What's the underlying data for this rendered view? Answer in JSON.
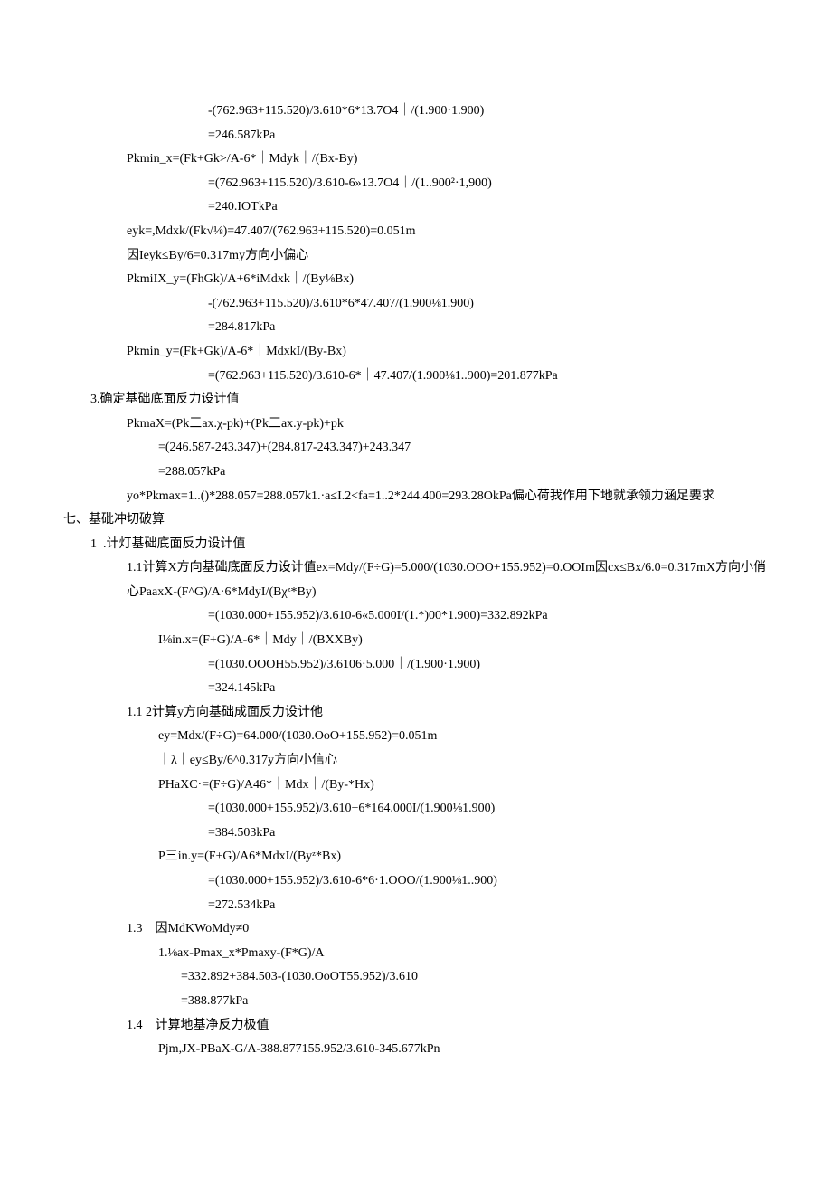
{
  "lines": [
    {
      "indent": 4,
      "text": "-(762.963+115.520)/3.610*6*13.7O4｜/(1.900·1.900)"
    },
    {
      "indent": 4,
      "text": "=246.587kPa"
    },
    {
      "indent": 2,
      "text": "Pkmin_x=(Fk+Gk>/A-6*｜Mdyk｜/(Bx-By)"
    },
    {
      "indent": 4,
      "text": "=(762.963+115.520)/3.610-6»13.7O4｜/(1..900²·1,900)"
    },
    {
      "indent": 4,
      "text": "=240.IOTkPa"
    },
    {
      "indent": 2,
      "text": "eyk=,Mdxk/(Fk√⅛)=47.407/(762.963+115.520)=0.051m"
    },
    {
      "indent": 2,
      "text": "因Ieyk≤By/6=0.317my方向小偏心"
    },
    {
      "indent": 2,
      "text": "PkmiIX_y=(FhGk)/A+6*iMdxk｜/(By⅛Bx)"
    },
    {
      "indent": 4,
      "text": "-(762.963+115.520)/3.610*6*47.407/(1.900⅛1.900)"
    },
    {
      "indent": 4,
      "text": "=284.817kPa"
    },
    {
      "indent": 2,
      "text": "Pkmin_y=(Fk+Gk)/A-6*｜MdxkI/(By-Bx)"
    },
    {
      "indent": 4,
      "text": "=(762.963+115.520)/3.610-6*｜47.407/(1.900⅛1..900)=201.877kPa"
    },
    {
      "indent": 1,
      "text": "3.确定基础底面反力设计值"
    },
    {
      "indent": 2,
      "text": "PkmaX=(Pk三ax.χ-pk)+(Pk三ax.y-pk)+pk"
    },
    {
      "indent": 3,
      "text": "=(246.587-243.347)+(284.817-243.347)+243.347"
    },
    {
      "indent": 3,
      "text": "=288.057kPa"
    },
    {
      "indent": 2,
      "text": "yo*Pkmax=1..()*288.057=288.057k1.·a≤I.2<fa=1..2*244.400=293.28OkPa偏心荷我作用下地就承领力涵足要求"
    },
    {
      "indent": 0,
      "text": "七、基砒冲切破算"
    },
    {
      "indent": 1,
      "text": "1  .计灯基础底面反力设计值"
    },
    {
      "indent": 2,
      "text": "1.1计算X方向基础底面反力设计值ex=Mdy/(F÷G)=5.000/(1030.OOO+155.952)=0.OOIm因cx≤Bx/6.0=0.317mX方向小俏心PaaxX-(F^G)/A·6*MdyI/(Bχᶻ*By)"
    },
    {
      "indent": 4,
      "text": "=(1030.000+155.952)/3.610-6«5.000I/(1.*)00*1.900)=332.892kPa"
    },
    {
      "indent": 3,
      "text": "I⅛in.x=(F+G)/A-6*｜Mdy｜/(BXXBy)"
    },
    {
      "indent": 4,
      "text": "=(1030.OOOH55.952)/3.6106·5.000｜/(1.900·1.900)"
    },
    {
      "indent": 4,
      "text": "=324.145kPa"
    },
    {
      "indent": 2,
      "text": "1.1 2计算y方向基础成面反力设计他"
    },
    {
      "indent": 3,
      "text": "ey=Mdx/(F÷G)=64.000/(1030.OoO+155.952)=0.051m"
    },
    {
      "indent": 3,
      "text": "｜λ｜ey≤By/6^0.317y方向小信心"
    },
    {
      "indent": 3,
      "text": "PHaXC·=(F÷G)/A46*｜Mdx｜/(By-*Hx)"
    },
    {
      "indent": 4,
      "text": "=(1030.000+155.952)/3.610+6*164.000I/(1.900⅛1.900)"
    },
    {
      "indent": 4,
      "text": "=384.503kPa"
    },
    {
      "indent": 3,
      "text": "P三in.y=(F+G)/A6*MdxI/(Byᶻ*Bx)"
    },
    {
      "indent": 4,
      "text": "=(1030.000+155.952)/3.610-6*6·1.OOO/(1.900⅛1..900)"
    },
    {
      "indent": 4,
      "text": "=272.534kPa"
    },
    {
      "indent": 2,
      "text": "1.3    因MdKWoMdy≠0"
    },
    {
      "indent": 3,
      "text": "1.⅛ax-Pmax_x*Pmaxy-(F*G)/A"
    },
    {
      "indent": 5,
      "text": "=332.892+384.503-(1030.OoOT55.952)/3.610"
    },
    {
      "indent": 5,
      "text": "=388.877kPa"
    },
    {
      "indent": 2,
      "text": "1.4    计算地基净反力极值"
    },
    {
      "indent": 3,
      "text": "Pjm,JX-PBaX-G/A-388.877155.952/3.610-345.677kPn"
    }
  ]
}
